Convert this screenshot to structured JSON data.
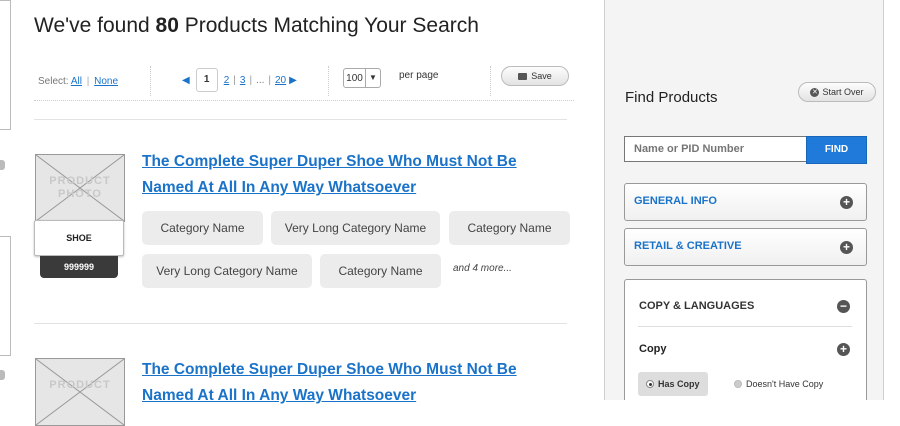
{
  "results": {
    "prefix": "We've found",
    "count": "80",
    "suffix": "Products Matching Your Search"
  },
  "toolbar": {
    "select_label": "Select:",
    "select_all": "All",
    "select_sep": "|",
    "select_none": "None",
    "pagination": {
      "prev_icon": "left-triangle-icon",
      "current": "1",
      "pages": [
        "2",
        "3",
        "...",
        "20"
      ],
      "next_icon": "right-triangle-icon"
    },
    "per_page_value": "100",
    "per_page_label": "per page",
    "save_label": "Save"
  },
  "products": [
    {
      "title_line1": "The Complete Super Duper Shoe Who Must Not Be",
      "title_line2": "Named At All In Any Way Whatsoever",
      "photo_placeholder_line1": "PRODUCT",
      "photo_placeholder_line2": "PHOTO",
      "type_label": "SHOE",
      "pid": "999999",
      "categories_row1": [
        "Category Name",
        "Very Long Category Name",
        "Category Name"
      ],
      "categories_row2": [
        "Very Long Category Name",
        "Category Name"
      ],
      "more_text": "and 4 more..."
    },
    {
      "title_line1": "The Complete Super Duper Shoe Who Must Not Be",
      "title_line2": "Named At All In Any Way Whatsoever",
      "photo_placeholder_line1": "PRODUCT"
    }
  ],
  "sidebar": {
    "title": "Find Products",
    "start_over_label": "Start Over",
    "search_placeholder": "Name or PID Number",
    "find_label": "FIND",
    "sections": [
      {
        "label": "GENERAL INFO",
        "state": "collapsed",
        "icon": "plus-circle-icon"
      },
      {
        "label": "RETAIL & CREATIVE",
        "state": "collapsed",
        "icon": "plus-circle-icon"
      },
      {
        "label": "COPY & LANGUAGES",
        "state": "expanded",
        "icon": "minus-circle-icon"
      }
    ],
    "copy": {
      "label": "Copy",
      "icon": "plus-circle-icon",
      "options": [
        {
          "label": "Has Copy",
          "selected": true
        },
        {
          "label": "Doesn't Have Copy",
          "selected": false
        }
      ]
    }
  },
  "colors": {
    "link": "#1a73c9",
    "find_button": "#1f7ad9",
    "pid_badge": "#3a3a3a",
    "chip_bg": "#ececec",
    "panel_bg": "#f4f4f4"
  }
}
